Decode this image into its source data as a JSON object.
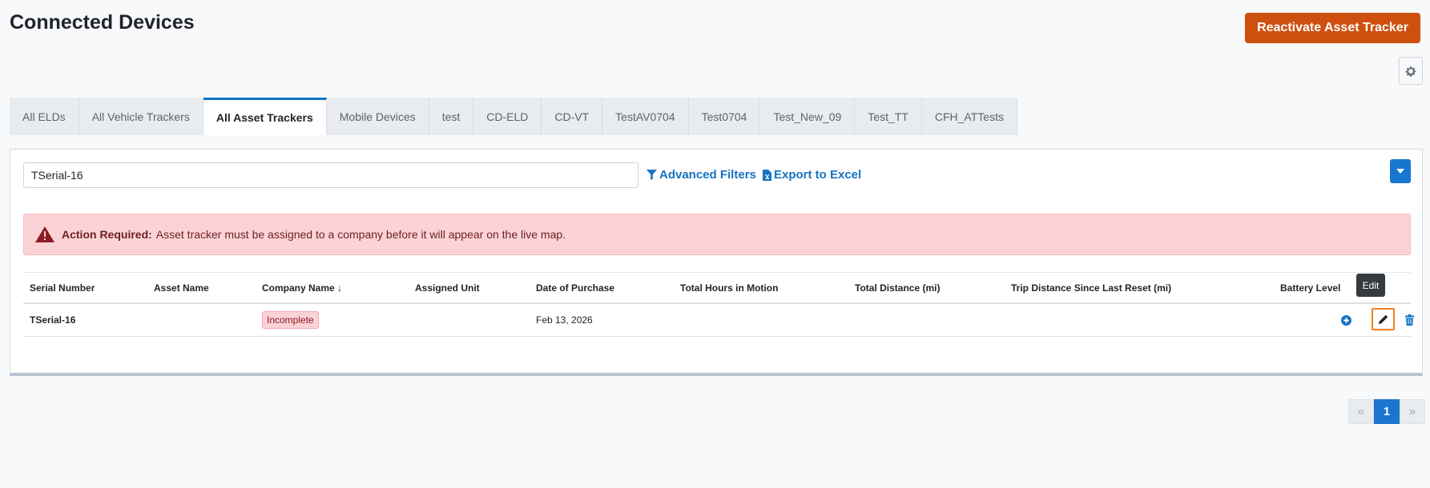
{
  "page": {
    "title": "Connected Devices"
  },
  "header": {
    "reactivate_label": "Reactivate Asset Tracker"
  },
  "tabs": [
    {
      "label": "All ELDs",
      "active": false
    },
    {
      "label": "All Vehicle Trackers",
      "active": false
    },
    {
      "label": "All Asset Trackers",
      "active": true
    },
    {
      "label": "Mobile Devices",
      "active": false
    },
    {
      "label": "test",
      "active": false
    },
    {
      "label": "CD-ELD",
      "active": false
    },
    {
      "label": "CD-VT",
      "active": false
    },
    {
      "label": "TestAV0704",
      "active": false
    },
    {
      "label": "Test0704",
      "active": false
    },
    {
      "label": "Test_New_09",
      "active": false
    },
    {
      "label": "Test_TT",
      "active": false
    },
    {
      "label": "CFH_ATTests",
      "active": false
    }
  ],
  "search": {
    "value": "TSerial-16"
  },
  "toolbar": {
    "advanced_filters": "Advanced Filters",
    "export_excel": "Export to Excel"
  },
  "alert": {
    "strong": "Action Required:",
    "message": "Asset tracker must be assigned to a company before it will appear on the live map."
  },
  "table": {
    "headers": {
      "serial": "Serial Number",
      "asset_name": "Asset Name",
      "company": "Company Name",
      "sort_indicator": "↓",
      "assigned_unit": "Assigned Unit",
      "purchase_date": "Date of Purchase",
      "hours_motion": "Total Hours in Motion",
      "total_distance": "Total Distance (mi)",
      "trip_distance": "Trip Distance Since Last Reset (mi)",
      "battery": "Battery Level"
    },
    "rows": [
      {
        "serial": "TSerial-16",
        "asset_name": "",
        "company_badge": "Incomplete",
        "assigned_unit": "",
        "purchase_date": "Feb 13, 2026",
        "hours_motion": "",
        "total_distance": "",
        "trip_distance": "",
        "battery": ""
      }
    ]
  },
  "tooltip": {
    "text": "Edit"
  },
  "pagination": {
    "prev": "«",
    "current": "1",
    "next": "»"
  },
  "colors": {
    "accent": "#1a76d0",
    "brand_orange": "#cf4f0f",
    "alert_bg": "#fbd3d6",
    "focus_outline": "#f08223"
  }
}
